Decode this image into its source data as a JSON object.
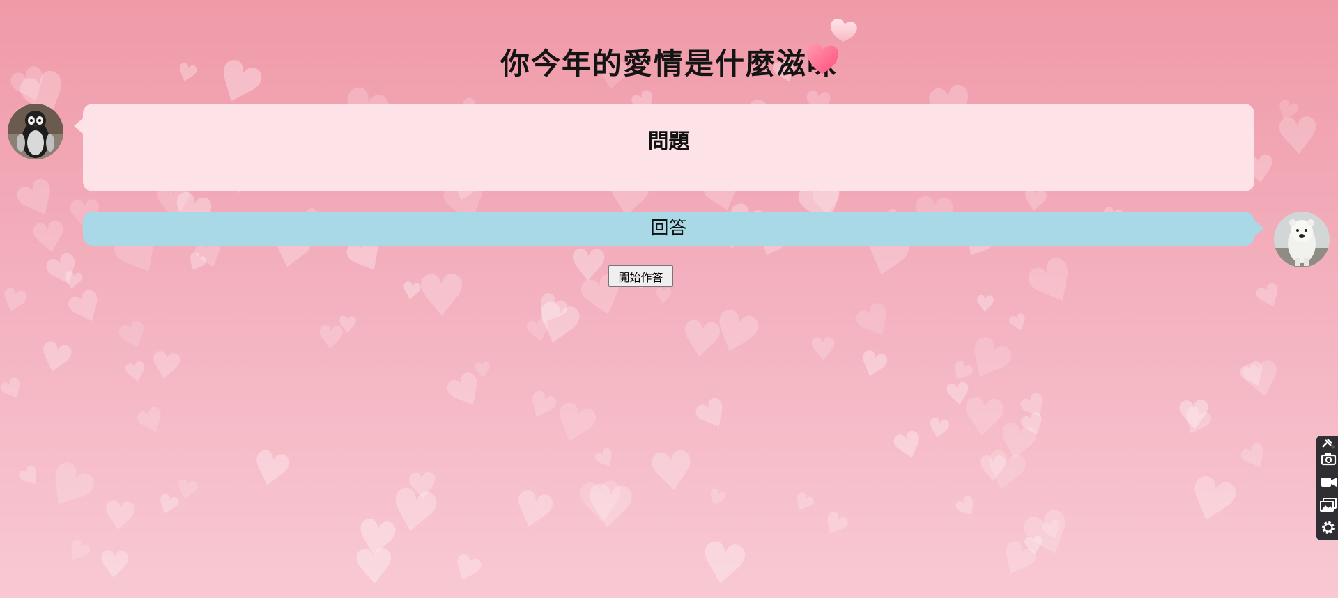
{
  "page": {
    "title": "你今年的愛情是什麼滋味"
  },
  "chat": {
    "question_label": "問題",
    "answer_label": "回答"
  },
  "actions": {
    "start_label": "開始作答"
  },
  "toolbar": {
    "icons": [
      "pin-icon",
      "camera-icon",
      "video-icon",
      "image-icon",
      "gear-icon"
    ]
  },
  "colors": {
    "question_bubble": "#fde3e8",
    "answer_bubble": "#a9d8e6",
    "background_top": "#f09aa8",
    "background_bottom": "#f8c9d3"
  }
}
